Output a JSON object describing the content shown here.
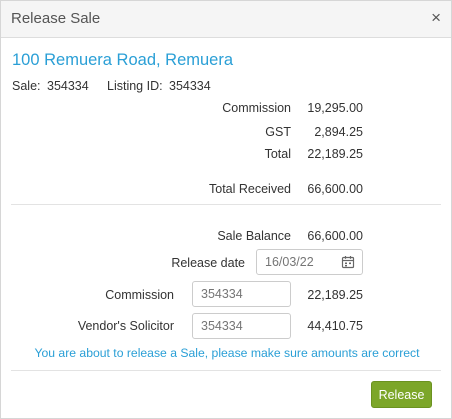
{
  "dialog": {
    "title": "Release Sale",
    "close_glyph": "×"
  },
  "property": {
    "address": "100 Remuera Road, Remuera",
    "sale_label": "Sale:",
    "sale_value": "354334",
    "listing_label": "Listing ID:",
    "listing_value": "354334"
  },
  "summary": {
    "commission_label": "Commission",
    "commission_value": "19,295.00",
    "gst_label": "GST",
    "gst_value": "2,894.25",
    "total_label": "Total",
    "total_value": "22,189.25",
    "total_received_label": "Total Received",
    "total_received_value": "66,600.00"
  },
  "release": {
    "sale_balance_label": "Sale Balance",
    "sale_balance_value": "66,600.00",
    "release_date_label": "Release date",
    "release_date_placeholder": "16/03/22",
    "commission_label": "Commission",
    "commission_placeholder": "354334",
    "commission_amount": "22,189.25",
    "vendor_solicitor_label": "Vendor's Solicitor",
    "vendor_solicitor_placeholder": "354334",
    "vendor_solicitor_amount": "44,410.75"
  },
  "warning_text": "You are about to release a Sale, please make sure amounts are correct",
  "actions": {
    "release_label": "Release"
  },
  "colors": {
    "accent": "#2a9fd6",
    "button": "#7ca629"
  },
  "icons": {
    "close": "close-icon",
    "calendar": "calendar-icon"
  }
}
